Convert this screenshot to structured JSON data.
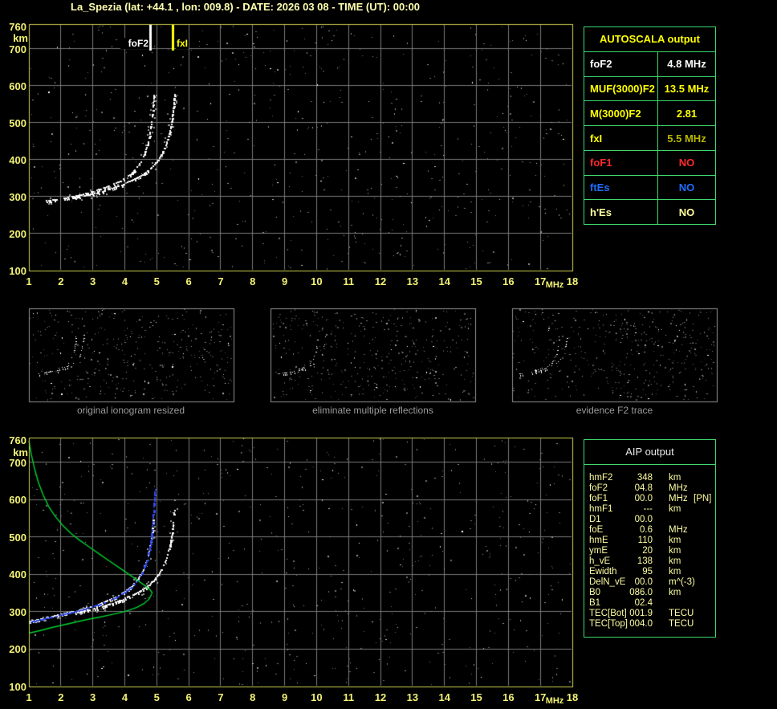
{
  "title": "La_Spezia (lat: +44.1 , lon: 009.8) - DATE: 2026 03 08 - TIME (UT): 00:00",
  "colors": {
    "plot_border": "#cfcf52",
    "tick_text": "#f2f274",
    "grid": "#7a7a7a",
    "table_border": "#3ed86e",
    "header_yellow": "#ffff00",
    "pale_yellow": "#ffffa2",
    "white": "#ffffff",
    "red": "#ff2a2a",
    "blue": "#1e6eff",
    "olive": "#b8b800",
    "trace_blue": "#2f4bf0",
    "profile_green": "#00d22e",
    "caption_gray": "#9a9a9a"
  },
  "axes": {
    "x_ticks": [
      "1",
      "2",
      "3",
      "4",
      "5",
      "6",
      "7",
      "8",
      "9",
      "10",
      "11",
      "12",
      "13",
      "14",
      "15",
      "16",
      "17",
      "18"
    ],
    "x_unit": "MHz",
    "y_ticks": [
      "760",
      "700",
      "600",
      "500",
      "400",
      "300",
      "200",
      "100"
    ],
    "y_tick_values": [
      760,
      700,
      600,
      500,
      400,
      300,
      200,
      100
    ],
    "y_unit": "km",
    "x_range": [
      1,
      18
    ],
    "y_range": [
      100,
      760
    ]
  },
  "autoscala_table": {
    "header": "AUTOSCALA output",
    "rows": [
      {
        "label": "foF2",
        "value": "4.8 MHz",
        "label_color": "#ffffff",
        "value_color": "#ffffff"
      },
      {
        "label": "MUF(3000)F2",
        "value": "13.5 MHz",
        "label_color": "#ffff00",
        "value_color": "#ffff00"
      },
      {
        "label": "M(3000)F2",
        "value": "2.81",
        "label_color": "#ffff00",
        "value_color": "#ffff00"
      },
      {
        "label": "fxI",
        "value": "5.5 MHz",
        "label_color": "#ffff00",
        "value_color": "#b8b800"
      },
      {
        "label": "foF1",
        "value": "NO",
        "label_color": "#ff2a2a",
        "value_color": "#ff2a2a"
      },
      {
        "label": "ftEs",
        "value": "NO",
        "label_color": "#1e6eff",
        "value_color": "#1e6eff"
      },
      {
        "label": "h'Es",
        "value": "NO",
        "label_color": "#ffff9e",
        "value_color": "#ffff9e"
      }
    ]
  },
  "aip_table": {
    "header": "AIP output",
    "rows": [
      {
        "label": "hmF2",
        "value": "348",
        "unit": "km",
        "extra": ""
      },
      {
        "label": "foF2",
        "value": "04.8",
        "unit": "MHz",
        "extra": ""
      },
      {
        "label": "foF1",
        "value": "00.0",
        "unit": "MHz",
        "extra": "[PN]"
      },
      {
        "label": "hmF1",
        "value": "---",
        "unit": "km",
        "extra": ""
      },
      {
        "label": "D1",
        "value": "00.0",
        "unit": "",
        "extra": ""
      },
      {
        "label": "foE",
        "value": "0.6",
        "unit": "MHz",
        "extra": ""
      },
      {
        "label": "hmE",
        "value": "110",
        "unit": "km",
        "extra": ""
      },
      {
        "label": "ymE",
        "value": "20",
        "unit": "km",
        "extra": ""
      },
      {
        "label": "h_vE",
        "value": "138",
        "unit": "km",
        "extra": ""
      },
      {
        "label": "Ewidth",
        "value": "95",
        "unit": "km",
        "extra": ""
      },
      {
        "label": "DelN_vE",
        "value": "00.0",
        "unit": "m^(-3)",
        "extra": ""
      },
      {
        "label": "B0",
        "value": "086.0",
        "unit": "km",
        "extra": ""
      },
      {
        "label": "B1",
        "value": "02.4",
        "unit": "",
        "extra": ""
      },
      {
        "label": "TEC[Bot]",
        "value": "001.9",
        "unit": "TECU",
        "extra": ""
      },
      {
        "label": "TEC[Top]",
        "value": "004.0",
        "unit": "TECU",
        "extra": ""
      }
    ]
  },
  "thumbnails": [
    {
      "caption": "original ionogram resized"
    },
    {
      "caption": "eliminate multiple reflections"
    },
    {
      "caption": "evidence F2 trace"
    }
  ],
  "chart_data": {
    "type": "scatter",
    "xlabel": "MHz",
    "ylabel": "km",
    "x_range": [
      1,
      18
    ],
    "y_range": [
      100,
      760
    ],
    "grid": true,
    "panels": [
      {
        "id": "ionogram",
        "markers": [
          {
            "label": "foF2",
            "mhz": 4.8,
            "color": "#ffffff"
          },
          {
            "label": "fxI",
            "mhz": 5.5,
            "color": "#ffff00"
          }
        ],
        "series": [
          {
            "name": "o-mode-echo-trace",
            "color": "#ffffff",
            "points": [
              [
                1.55,
                287
              ],
              [
                1.8,
                290
              ],
              [
                2.1,
                294
              ],
              [
                2.4,
                299
              ],
              [
                2.7,
                305
              ],
              [
                3.0,
                312
              ],
              [
                3.3,
                321
              ],
              [
                3.6,
                331
              ],
              [
                3.9,
                343
              ],
              [
                4.15,
                357
              ],
              [
                4.35,
                374
              ],
              [
                4.5,
                393
              ],
              [
                4.62,
                415
              ],
              [
                4.72,
                442
              ],
              [
                4.79,
                472
              ],
              [
                4.84,
                505
              ],
              [
                4.88,
                542
              ],
              [
                4.91,
                578
              ]
            ]
          },
          {
            "name": "x-mode-echo-trace",
            "color": "#ffffff",
            "points": [
              [
                2.45,
                296
              ],
              [
                2.75,
                301
              ],
              [
                3.05,
                307
              ],
              [
                3.35,
                314
              ],
              [
                3.65,
                322
              ],
              [
                3.95,
                332
              ],
              [
                4.25,
                344
              ],
              [
                4.55,
                358
              ],
              [
                4.8,
                374
              ],
              [
                5.0,
                393
              ],
              [
                5.17,
                415
              ],
              [
                5.3,
                442
              ],
              [
                5.4,
                472
              ],
              [
                5.47,
                505
              ],
              [
                5.52,
                542
              ],
              [
                5.56,
                580
              ]
            ]
          }
        ]
      },
      {
        "id": "profile",
        "markers": [],
        "series": [
          {
            "name": "o-mode-echo-trace",
            "color": "#ffffff",
            "points": [
              [
                1.0,
                273
              ],
              [
                1.3,
                278
              ],
              [
                1.6,
                284
              ],
              [
                1.9,
                290
              ],
              [
                2.2,
                296
              ],
              [
                2.5,
                302
              ],
              [
                2.8,
                309
              ],
              [
                3.1,
                317
              ],
              [
                3.4,
                326
              ],
              [
                3.7,
                337
              ],
              [
                3.95,
                350
              ],
              [
                4.2,
                366
              ],
              [
                4.4,
                385
              ],
              [
                4.55,
                407
              ],
              [
                4.68,
                434
              ],
              [
                4.77,
                466
              ],
              [
                4.83,
                500
              ],
              [
                4.88,
                538
              ],
              [
                4.91,
                575
              ]
            ]
          },
          {
            "name": "x-mode-echo-trace",
            "color": "#ffffff",
            "points": [
              [
                2.45,
                296
              ],
              [
                2.75,
                301
              ],
              [
                3.05,
                307
              ],
              [
                3.35,
                314
              ],
              [
                3.65,
                322
              ],
              [
                3.95,
                332
              ],
              [
                4.25,
                344
              ],
              [
                4.55,
                358
              ],
              [
                4.8,
                374
              ],
              [
                5.0,
                393
              ],
              [
                5.17,
                415
              ],
              [
                5.3,
                442
              ],
              [
                5.4,
                472
              ],
              [
                5.47,
                505
              ],
              [
                5.52,
                542
              ],
              [
                5.56,
                580
              ]
            ]
          },
          {
            "name": "restored-f2-trace",
            "color": "#2f4bf0",
            "points": [
              [
                1.0,
                270
              ],
              [
                1.3,
                276
              ],
              [
                1.6,
                282
              ],
              [
                1.9,
                288
              ],
              [
                2.2,
                294
              ],
              [
                2.5,
                300
              ],
              [
                2.8,
                307
              ],
              [
                3.1,
                315
              ],
              [
                3.4,
                324
              ],
              [
                3.7,
                335
              ],
              [
                3.95,
                348
              ],
              [
                4.2,
                364
              ],
              [
                4.4,
                383
              ],
              [
                4.55,
                405
              ],
              [
                4.68,
                432
              ],
              [
                4.77,
                464
              ],
              [
                4.83,
                498
              ],
              [
                4.87,
                534
              ],
              [
                4.9,
                570
              ],
              [
                4.93,
                605
              ],
              [
                4.95,
                630
              ]
            ]
          },
          {
            "name": "density-profile-topside",
            "color": "#00d22e",
            "points": [
              [
                1.0,
                758
              ],
              [
                1.08,
                720
              ],
              [
                1.18,
                682
              ],
              [
                1.3,
                646
              ],
              [
                1.45,
                612
              ],
              [
                1.62,
                582
              ],
              [
                1.82,
                556
              ],
              [
                2.05,
                532
              ],
              [
                2.3,
                511
              ],
              [
                2.58,
                492
              ],
              [
                2.88,
                474
              ],
              [
                3.2,
                455
              ],
              [
                3.52,
                436
              ],
              [
                3.85,
                417
              ],
              [
                4.15,
                399
              ],
              [
                4.42,
                383
              ],
              [
                4.65,
                369
              ],
              [
                4.8,
                358
              ],
              [
                4.86,
                351
              ]
            ]
          },
          {
            "name": "density-profile-bottomside",
            "color": "#00d22e",
            "points": [
              [
                4.86,
                351
              ],
              [
                4.76,
                334
              ],
              [
                4.6,
                322
              ],
              [
                4.38,
                312
              ],
              [
                4.12,
                304
              ],
              [
                3.82,
                297
              ],
              [
                3.5,
                291
              ],
              [
                3.16,
                285
              ],
              [
                2.8,
                279
              ],
              [
                2.44,
                272
              ],
              [
                2.08,
                265
              ],
              [
                1.72,
                258
              ],
              [
                1.36,
                250
              ],
              [
                1.0,
                243
              ]
            ]
          }
        ]
      }
    ]
  }
}
